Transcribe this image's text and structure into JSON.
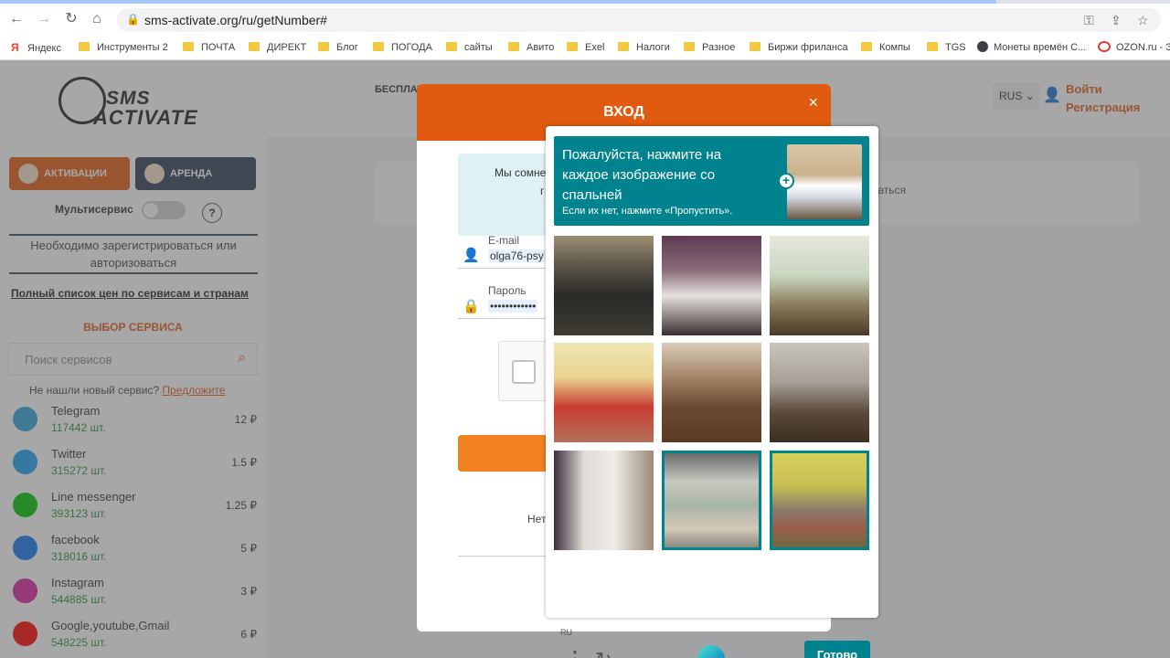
{
  "browser": {
    "url": "sms-activate.org/ru/getNumber#",
    "bookmarks": [
      {
        "label": "Яндекс",
        "icon": "yandex-icon"
      },
      {
        "label": "Инструменты 2",
        "icon": "folder-icon"
      },
      {
        "label": "ПОЧТА",
        "icon": "folder-icon"
      },
      {
        "label": "ДИРЕКТ",
        "icon": "folder-icon"
      },
      {
        "label": "Блог",
        "icon": "folder-icon"
      },
      {
        "label": "ПОГОДА",
        "icon": "folder-icon"
      },
      {
        "label": "сайты",
        "icon": "folder-icon"
      },
      {
        "label": "Авито",
        "icon": "folder-icon"
      },
      {
        "label": "Exel",
        "icon": "folder-icon"
      },
      {
        "label": "Налоги",
        "icon": "folder-icon"
      },
      {
        "label": "Разное",
        "icon": "folder-icon"
      },
      {
        "label": "Биржи фриланса",
        "icon": "folder-icon"
      },
      {
        "label": "Компы",
        "icon": "folder-icon"
      },
      {
        "label": "TGS",
        "icon": "folder-icon"
      },
      {
        "label": "Монеты времён С...",
        "icon": "globe-icon"
      },
      {
        "label": "OZON.ru - З",
        "icon": "ozon-icon"
      }
    ]
  },
  "sidebar": {
    "logo_line1": "SMS",
    "logo_line2": "ACTIVATE",
    "tab_activations": "АКТИВАЦИИ",
    "tab_rent": "АРЕНДА",
    "multiservice_label": "Мультисервис",
    "help_label": "?",
    "notice": "Необходимо зарегистрироваться или авторизоваться",
    "full_price_list": "Полный список цен по сервисам и странам",
    "choose_service": "ВЫБОР СЕРВИСА",
    "search_placeholder": "Поиск сервисов",
    "not_found_text": "Не нашли новый сервис?",
    "suggest_link": "Предложите",
    "services": [
      {
        "name": "Telegram",
        "count": "117442 шт.",
        "price": "12 ₽",
        "color": "#2fa3d9"
      },
      {
        "name": "Twitter",
        "count": "315272 шт.",
        "price": "1.5 ₽",
        "color": "#1da1f2"
      },
      {
        "name": "Line messenger",
        "count": "393123 шт.",
        "price": "1.25 ₽",
        "color": "#00c300"
      },
      {
        "name": "facebook",
        "count": "318016 шт.",
        "price": "5 ₽",
        "color": "#1877f2"
      },
      {
        "name": "Instagram",
        "count": "544885 шт.",
        "price": "3 ₽",
        "color": "#d6249f"
      },
      {
        "name": "Google,youtube,Gmail",
        "count": "548225 шт.",
        "price": "6 ₽",
        "color": "#ff0000"
      }
    ]
  },
  "header": {
    "free_label": "БЕСПЛАТ",
    "lang": "RUS",
    "login": "Войти",
    "register": "Регистрация",
    "card_text_fragment": "аться"
  },
  "login_modal": {
    "title": "ВХОД",
    "close": "×",
    "info_fragment1": "Мы сомне",
    "info_fragment2": "г",
    "email_label": "E-mail",
    "email_value": "olga76-psy",
    "password_label": "Пароль",
    "password_value": "••••••••••••",
    "no_account_fragment": "Нет"
  },
  "hcaptcha": {
    "prompt": "Пожалуйста, нажмите на каждое изображение со спальней",
    "prompt_sub": "Если их нет, нажмите «Пропустить».",
    "lang": "RU",
    "done_label": "Готово",
    "tiles": [
      {
        "selected": false
      },
      {
        "selected": false
      },
      {
        "selected": false
      },
      {
        "selected": false
      },
      {
        "selected": false
      },
      {
        "selected": false
      },
      {
        "selected": false
      },
      {
        "selected": true
      },
      {
        "selected": true
      }
    ]
  },
  "colors": {
    "accent": "#e05a1a",
    "captcha_teal": "#00838f"
  }
}
